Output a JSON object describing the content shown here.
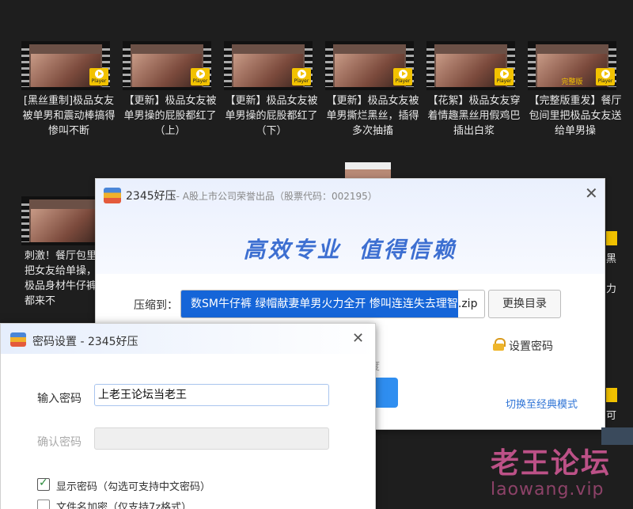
{
  "videos": [
    {
      "title": "[黑丝重制]极品女友被单男和震动棒搞得惨叫不断",
      "badge": "Player",
      "caption": ""
    },
    {
      "title": "【更新】极品女友被单男操的屁股都红了（上）",
      "badge": "Player",
      "caption": ""
    },
    {
      "title": "【更新】极品女友被单男操的屁股都红了（下）",
      "badge": "Player",
      "caption": ""
    },
    {
      "title": "【更新】极品女友被单男撕烂黑丝，插得多次抽搐",
      "badge": "Player",
      "caption": ""
    },
    {
      "title": "【花絮】极品女友穿着情趣黑丝用假鸡巴插出白浆",
      "badge": "Player",
      "caption": ""
    },
    {
      "title": "【完整版重发】餐厅包间里把极品女友送给单男操",
      "badge": "Player",
      "caption": "完整版"
    },
    {
      "title": "刺激！餐厅包里把女友给单操，极品身材牛仔裤都来不",
      "badge": "Player",
      "caption": ""
    }
  ],
  "compress_window": {
    "title": "2345好压",
    "subtitle": "- A股上市公司荣誉出品（股票代码：002195）",
    "slogan_1": "高效专业",
    "slogan_2": "值得信赖",
    "compress_to_label": "压缩到：",
    "path_selected": "数SM牛仔裤 绿帽献妻单男火力全开 惨叫连连失去理智",
    "path_ext": ".zip",
    "change_dir_button": "更换目录",
    "set_password": "设置密码",
    "speed_fragment": "度",
    "classic_mode_link": "切换至经典模式"
  },
  "password_dialog": {
    "title": "密码设置 - 2345好压",
    "password_label": "输入密码",
    "password_value": "上老王论坛当老王",
    "confirm_label": "确认密码",
    "confirm_value": "",
    "show_password_label": "显示密码（勾选可支持中文密码）",
    "show_password_checked": true,
    "encrypt_names_label": "文件名加密（仅支持7z格式）",
    "encrypt_names_checked": false
  },
  "watermark": {
    "text": "老王论坛",
    "url": "laowang.vip"
  },
  "edge_fragments": {
    "right_1": "黑",
    "right_2": "力",
    "right_3": "可"
  },
  "colors": {
    "accent": "#3d6fd1",
    "selection": "#1565d8",
    "badge": "#f2c200",
    "watermark": "#d85a9a"
  }
}
